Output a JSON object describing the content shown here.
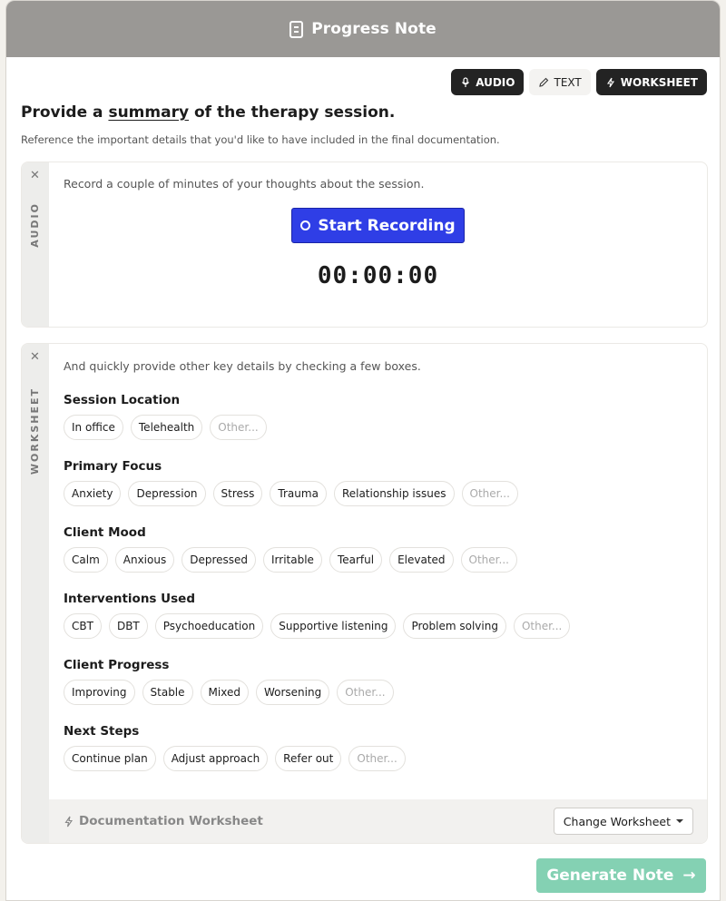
{
  "window": {
    "title": "Progress Note"
  },
  "modes": [
    {
      "label": "AUDIO",
      "icon": "mic-icon",
      "active": true
    },
    {
      "label": "TEXT",
      "icon": "pencil-icon",
      "active": false
    },
    {
      "label": "WORKSHEET",
      "icon": "lightning-icon",
      "active": true
    }
  ],
  "intro": {
    "heading_pre": "Provide a ",
    "heading_em": "summary",
    "heading_post": " of the therapy session.",
    "subheading": "Reference the important details that you'd like to have included in the final documentation."
  },
  "audio": {
    "rail_label": "AUDIO",
    "hint": "Record a couple of minutes of your thoughts about the session.",
    "record_label": "Start Recording",
    "timer": "00:00:00"
  },
  "worksheet": {
    "rail_label": "WORKSHEET",
    "hint": "And quickly provide other key details by checking a few boxes.",
    "groups": [
      {
        "title": "Session Location",
        "options": [
          "In office",
          "Telehealth"
        ],
        "other": "Other..."
      },
      {
        "title": "Primary Focus",
        "options": [
          "Anxiety",
          "Depression",
          "Stress",
          "Trauma",
          "Relationship issues"
        ],
        "other": "Other..."
      },
      {
        "title": "Client Mood",
        "options": [
          "Calm",
          "Anxious",
          "Depressed",
          "Irritable",
          "Tearful",
          "Elevated"
        ],
        "other": "Other..."
      },
      {
        "title": "Interventions Used",
        "options": [
          "CBT",
          "DBT",
          "Psychoeducation",
          "Supportive listening",
          "Problem solving"
        ],
        "other": "Other..."
      },
      {
        "title": "Client Progress",
        "options": [
          "Improving",
          "Stable",
          "Mixed",
          "Worsening"
        ],
        "other": "Other..."
      },
      {
        "title": "Next Steps",
        "options": [
          "Continue plan",
          "Adjust approach",
          "Refer out"
        ],
        "other": "Other..."
      }
    ],
    "footer_name": "Documentation Worksheet",
    "change_label": "Change Worksheet"
  },
  "generate": {
    "label": "Generate Note",
    "arrow": "→"
  },
  "colors": {
    "primary": "#2f3ee6",
    "generate": "#84d1b3",
    "titlebar": "#9a9895",
    "dark_button": "#232323"
  }
}
